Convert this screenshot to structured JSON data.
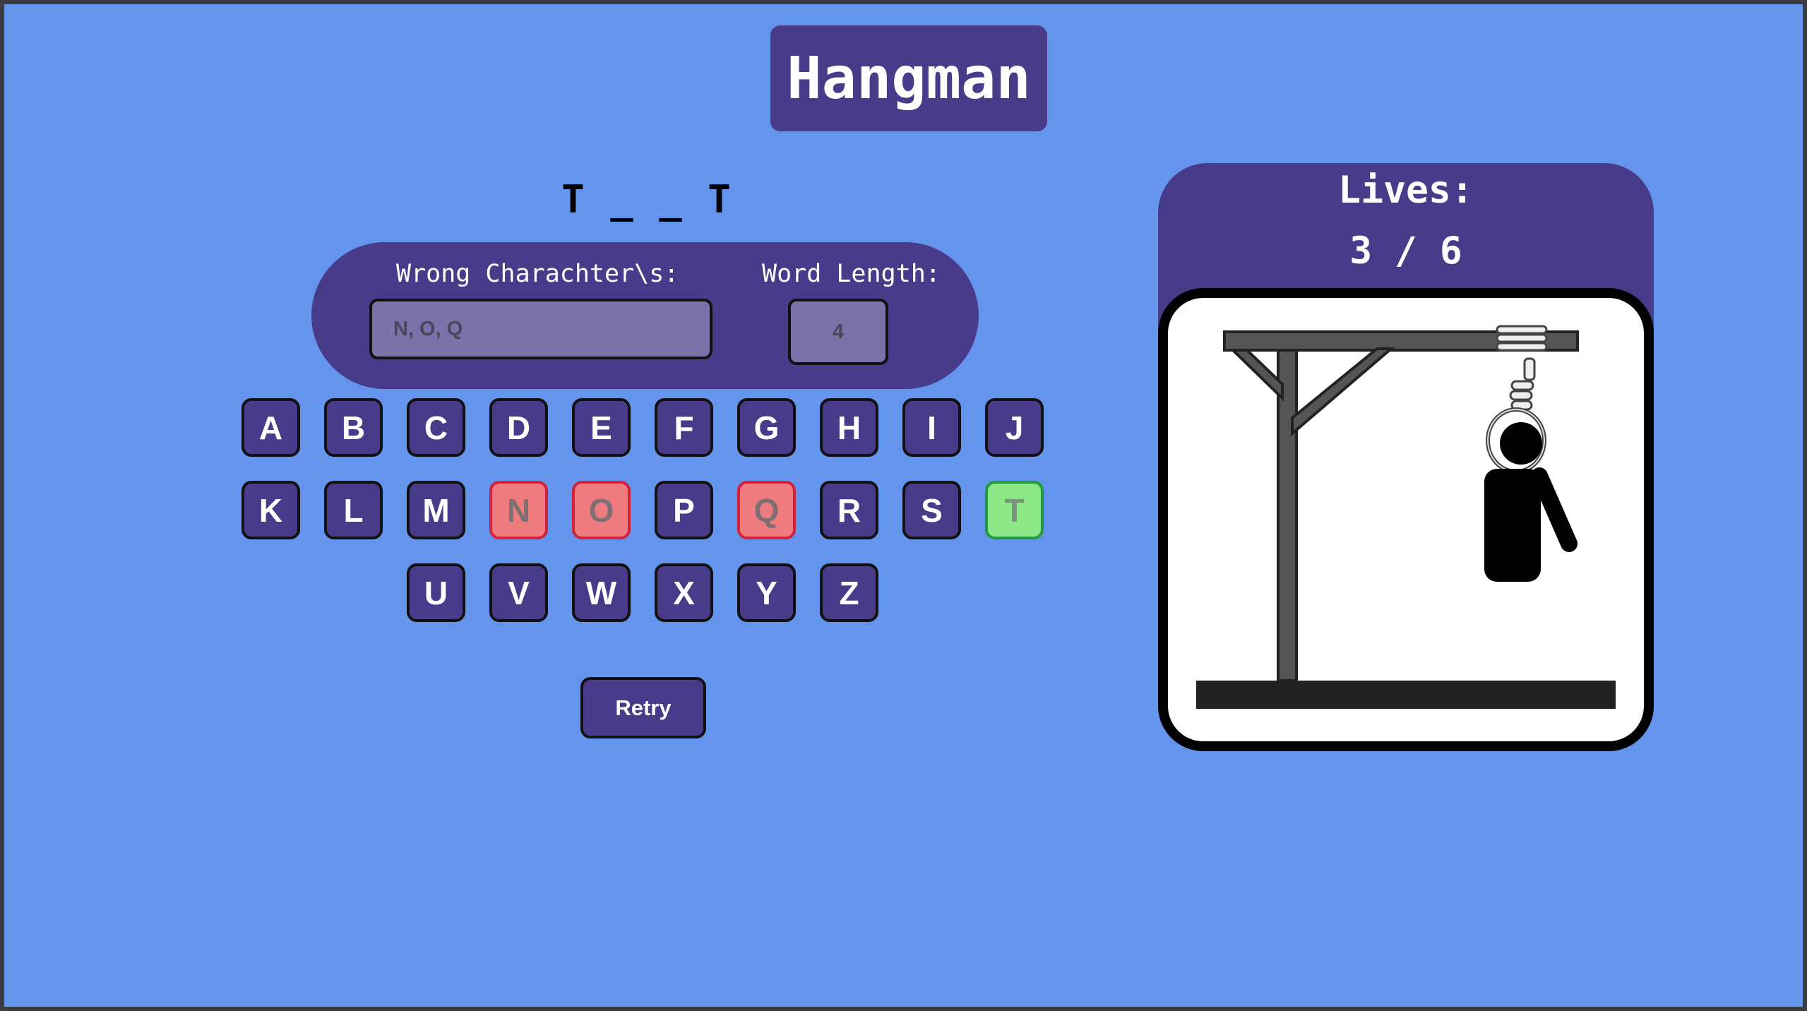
{
  "title": "Hangman",
  "word": {
    "display": "T _ _ T"
  },
  "info": {
    "wrong_label": "Wrong Charachter\\s:",
    "wrong_value": "N, O, Q",
    "length_label": "Word Length:",
    "length_value": "4"
  },
  "keyboard": {
    "row1": [
      "A",
      "B",
      "C",
      "D",
      "E",
      "F",
      "G",
      "H",
      "I",
      "J"
    ],
    "row2": [
      "K",
      "L",
      "M",
      "N",
      "O",
      "P",
      "Q",
      "R",
      "S",
      "T"
    ],
    "row3": [
      "U",
      "V",
      "W",
      "X",
      "Y",
      "Z"
    ],
    "wrong_letters": [
      "N",
      "O",
      "Q"
    ],
    "correct_letters": [
      "T"
    ]
  },
  "retry_label": "Retry",
  "lives": {
    "label": "Lives:",
    "count": "3 / 6",
    "remaining": 3,
    "total": 6
  },
  "colors": {
    "background": "#6594ec",
    "panel": "#473b8a",
    "wrong": "#ee7b7e",
    "correct": "#8ee787"
  },
  "figure": {
    "drawn_parts": [
      "head",
      "body",
      "right-arm"
    ]
  }
}
